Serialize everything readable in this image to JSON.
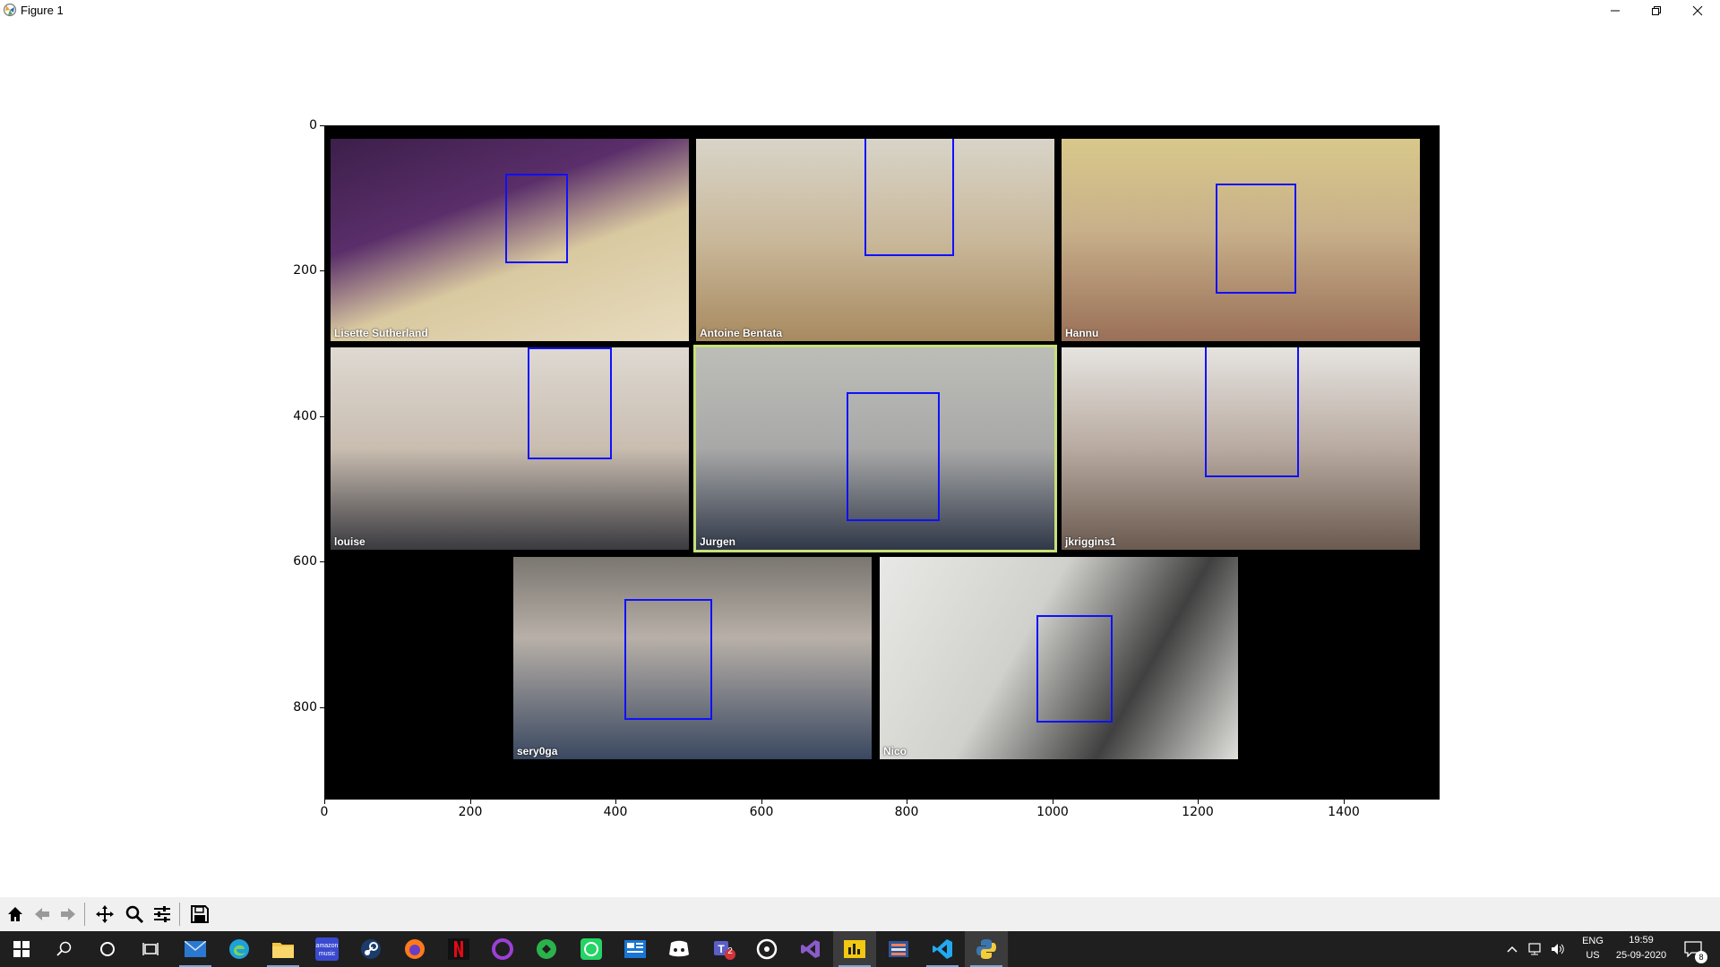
{
  "window": {
    "title": "Figure 1"
  },
  "plot": {
    "y_ticks": [
      "0",
      "200",
      "400",
      "600",
      "800"
    ],
    "x_ticks": [
      "0",
      "200",
      "400",
      "600",
      "800",
      "1000",
      "1200",
      "1400"
    ],
    "participants": [
      "Lisette Sutherland",
      "Antoine Bentata",
      "Hannu",
      "louise",
      "Jurgen",
      "jkriggins1",
      "sery0ga",
      "Nico"
    ],
    "active_speaker_color": "#c8e07a",
    "face_box_color": "#1010ff"
  },
  "toolbar": {
    "buttons": [
      "home-icon",
      "back-arrow-icon",
      "forward-arrow-icon",
      "pan-icon",
      "zoom-icon",
      "configure-subplots-icon",
      "save-icon"
    ]
  },
  "taskbar": {
    "apps": [
      "start-icon",
      "search-icon",
      "cortana-icon",
      "task-view-icon",
      "mail-icon",
      "edge-icon",
      "file-explorer-icon",
      "amazon-music-icon",
      "steam-icon",
      "firefox-icon",
      "netflix-icon",
      "obs-icon",
      "feedly-icon",
      "whatsapp-icon",
      "news-icon",
      "discord-icon",
      "teams-icon",
      "steam-vr-icon",
      "visual-studio-icon",
      "powerbi-icon",
      "app-icon",
      "vscode-icon",
      "python-icon"
    ],
    "teams_badge": "2",
    "language": "ENG",
    "region": "US",
    "time": "19:59",
    "date": "25-09-2020",
    "notifications": "8"
  }
}
